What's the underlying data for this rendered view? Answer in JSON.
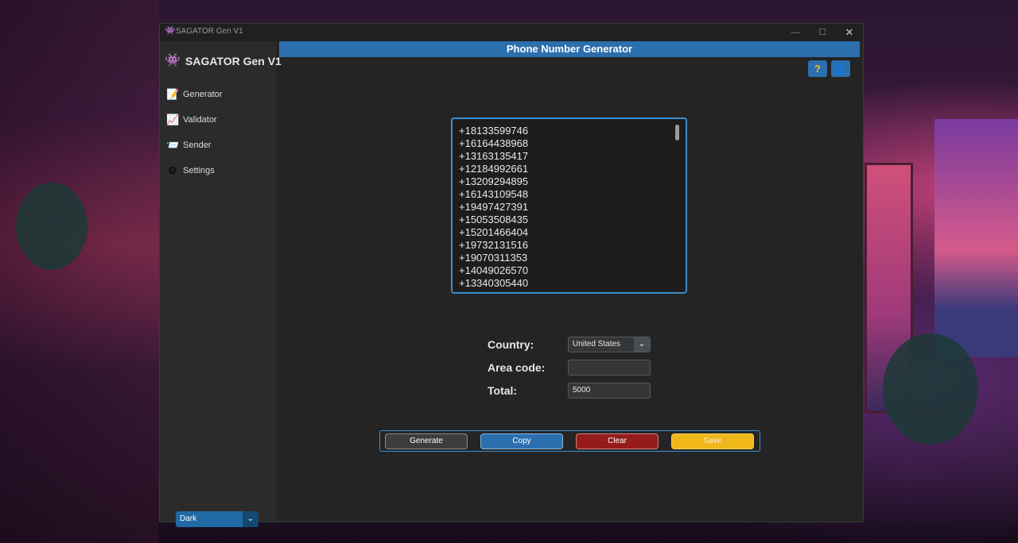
{
  "window": {
    "title": "SAGATOR Gen V1",
    "controls": {
      "minimize": "—",
      "maximize": "☐",
      "close": "✕"
    }
  },
  "sidebar": {
    "brand": "SAGATOR Gen V1",
    "brand_icon": "alien-icon",
    "items": [
      {
        "label": "Generator",
        "icon": "generator-icon"
      },
      {
        "label": "Validator",
        "icon": "validator-icon"
      },
      {
        "label": "Sender",
        "icon": "sender-icon"
      },
      {
        "label": "Settings",
        "icon": "settings-icon"
      }
    ],
    "theme": {
      "value": "Dark"
    }
  },
  "header": {
    "title": "Phone Number Generator",
    "help_icon": "help-icon",
    "profile_icon": "profile-icon"
  },
  "output": {
    "numbers": [
      "+18133599746",
      "+16164438968",
      "+13163135417",
      "+12184992661",
      "+13209294895",
      "+16143109548",
      "+19497427391",
      "+15053508435",
      "+15201466404",
      "+19732131516",
      "+19070311353",
      "+14049026570",
      "+13340305440"
    ]
  },
  "form": {
    "country_label": "Country:",
    "country_value": "United States",
    "area_code_label": "Area code:",
    "area_code_value": "",
    "total_label": "Total:",
    "total_value": "5000"
  },
  "actions": {
    "generate": "Generate",
    "copy": "Copy",
    "clear": "Clear",
    "save": "Save"
  },
  "colors": {
    "accent": "#2b6fae",
    "clear": "#961c1c",
    "save": "#f0b71a",
    "panel": "#242424",
    "sidebar": "#2b2b2b"
  }
}
